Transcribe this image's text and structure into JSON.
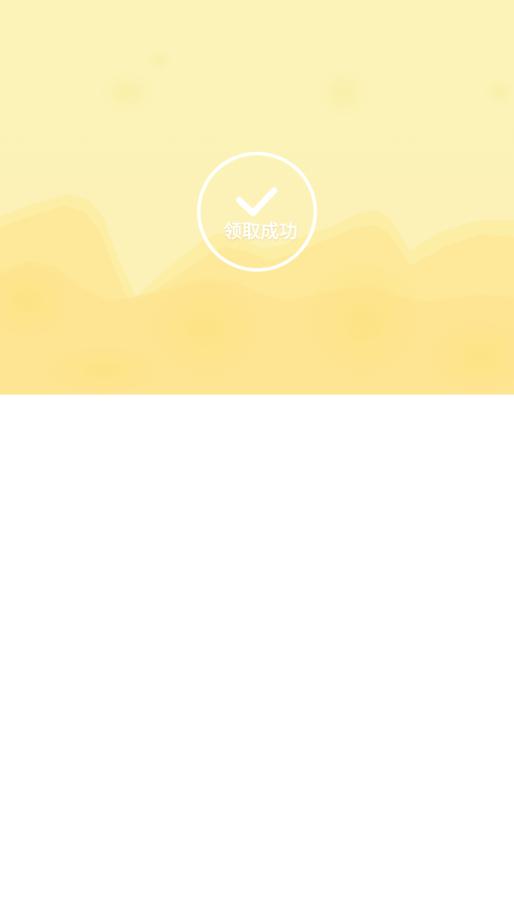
{
  "success": {
    "title": "领取成功",
    "icon": "check-icon"
  },
  "colors": {
    "hero_background": "#fbf3b8",
    "watercolor_light": "#fdf5c0",
    "watercolor_mid": "#fde993",
    "watercolor_deep": "#fde07e",
    "badge_stroke": "#ffffff",
    "content_background": "#ffffff"
  }
}
